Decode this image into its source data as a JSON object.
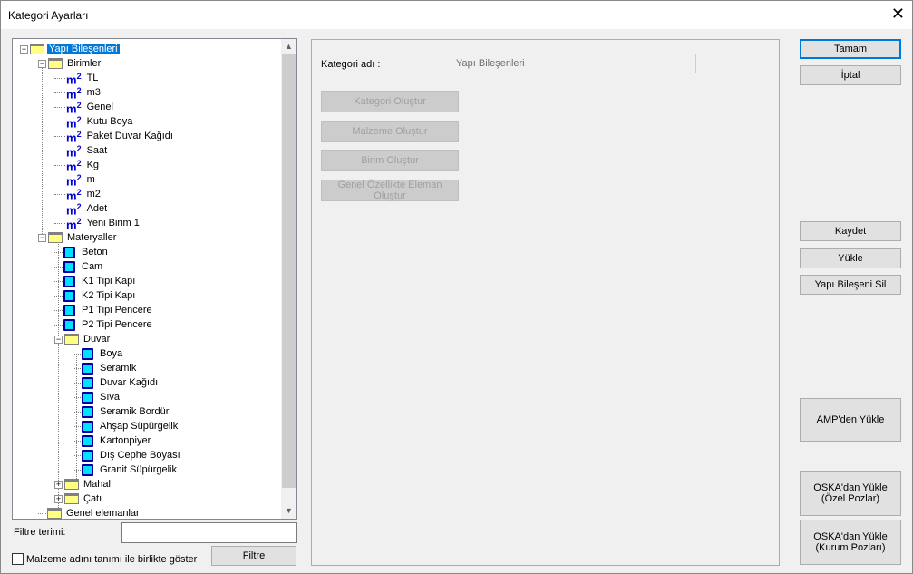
{
  "window": {
    "title": "Kategori Ayarları",
    "close": "✕"
  },
  "tree": [
    {
      "d": 0,
      "icon": "folder",
      "exp": "-",
      "label": "Yapı Bileşenleri",
      "selected": true
    },
    {
      "d": 1,
      "icon": "folder",
      "exp": "-",
      "label": "Birimler"
    },
    {
      "d": 2,
      "icon": "unit",
      "label": "TL"
    },
    {
      "d": 2,
      "icon": "unit",
      "label": "m3"
    },
    {
      "d": 2,
      "icon": "unit",
      "label": "Genel"
    },
    {
      "d": 2,
      "icon": "unit",
      "label": "Kutu Boya"
    },
    {
      "d": 2,
      "icon": "unit",
      "label": "Paket Duvar Kağıdı"
    },
    {
      "d": 2,
      "icon": "unit",
      "label": "Saat"
    },
    {
      "d": 2,
      "icon": "unit",
      "label": "Kg"
    },
    {
      "d": 2,
      "icon": "unit",
      "label": "m"
    },
    {
      "d": 2,
      "icon": "unit",
      "label": "m2"
    },
    {
      "d": 2,
      "icon": "unit",
      "label": "Adet"
    },
    {
      "d": 2,
      "icon": "unit",
      "label": "Yeni Birim 1"
    },
    {
      "d": 1,
      "icon": "folder",
      "exp": "-",
      "label": "Materyaller"
    },
    {
      "d": 2,
      "icon": "material",
      "label": "Beton"
    },
    {
      "d": 2,
      "icon": "material",
      "label": "Cam"
    },
    {
      "d": 2,
      "icon": "material",
      "label": "K1 Tipi Kapı"
    },
    {
      "d": 2,
      "icon": "material",
      "label": "K2 Tipi Kapı"
    },
    {
      "d": 2,
      "icon": "material",
      "label": "P1 Tipi Pencere"
    },
    {
      "d": 2,
      "icon": "material",
      "label": "P2 Tipi Pencere"
    },
    {
      "d": 2,
      "icon": "folder",
      "exp": "-",
      "label": "Duvar"
    },
    {
      "d": 3,
      "icon": "material",
      "label": "Boya"
    },
    {
      "d": 3,
      "icon": "material",
      "label": "Seramik"
    },
    {
      "d": 3,
      "icon": "material",
      "label": "Duvar Kağıdı"
    },
    {
      "d": 3,
      "icon": "material",
      "label": "Sıva"
    },
    {
      "d": 3,
      "icon": "material",
      "label": "Seramik Bordür"
    },
    {
      "d": 3,
      "icon": "material",
      "label": "Ahşap Süpürgelik"
    },
    {
      "d": 3,
      "icon": "material",
      "label": "Kartonpiyer"
    },
    {
      "d": 3,
      "icon": "material",
      "label": "Dış Cephe Boyası"
    },
    {
      "d": 3,
      "icon": "material",
      "label": "Granit Süpürgelik"
    },
    {
      "d": 2,
      "icon": "folder",
      "exp": "+",
      "label": "Mahal"
    },
    {
      "d": 2,
      "icon": "folder",
      "exp": "+",
      "label": "Çatı"
    },
    {
      "d": 1,
      "icon": "folder",
      "label": "Genel elemanlar"
    }
  ],
  "unit_glyph": "m",
  "unit_sup": "2",
  "filter": {
    "label": "Filtre terimi:",
    "value": "",
    "button": "Filtre",
    "checkbox_label": "Malzeme adını tanımı ile birlikte göster"
  },
  "panel": {
    "name_label": "Kategori adı :",
    "name_value": "Yapı Bileşenleri",
    "buttons": [
      "Kategori Oluştur",
      "Malzeme Oluştur",
      "Birim Oluştur",
      "Genel Özellikte Eleman Oluştur"
    ]
  },
  "right": {
    "ok": "Tamam",
    "cancel": "İptal",
    "save": "Kaydet",
    "load": "Yükle",
    "delete": "Yapı Bileşeni Sil",
    "amp": "AMP'den Yükle",
    "oska1": "OSKA'dan Yükle\n(Özel Pozlar)",
    "oska2": "OSKA'dan Yükle\n(Kurum Pozları)"
  }
}
